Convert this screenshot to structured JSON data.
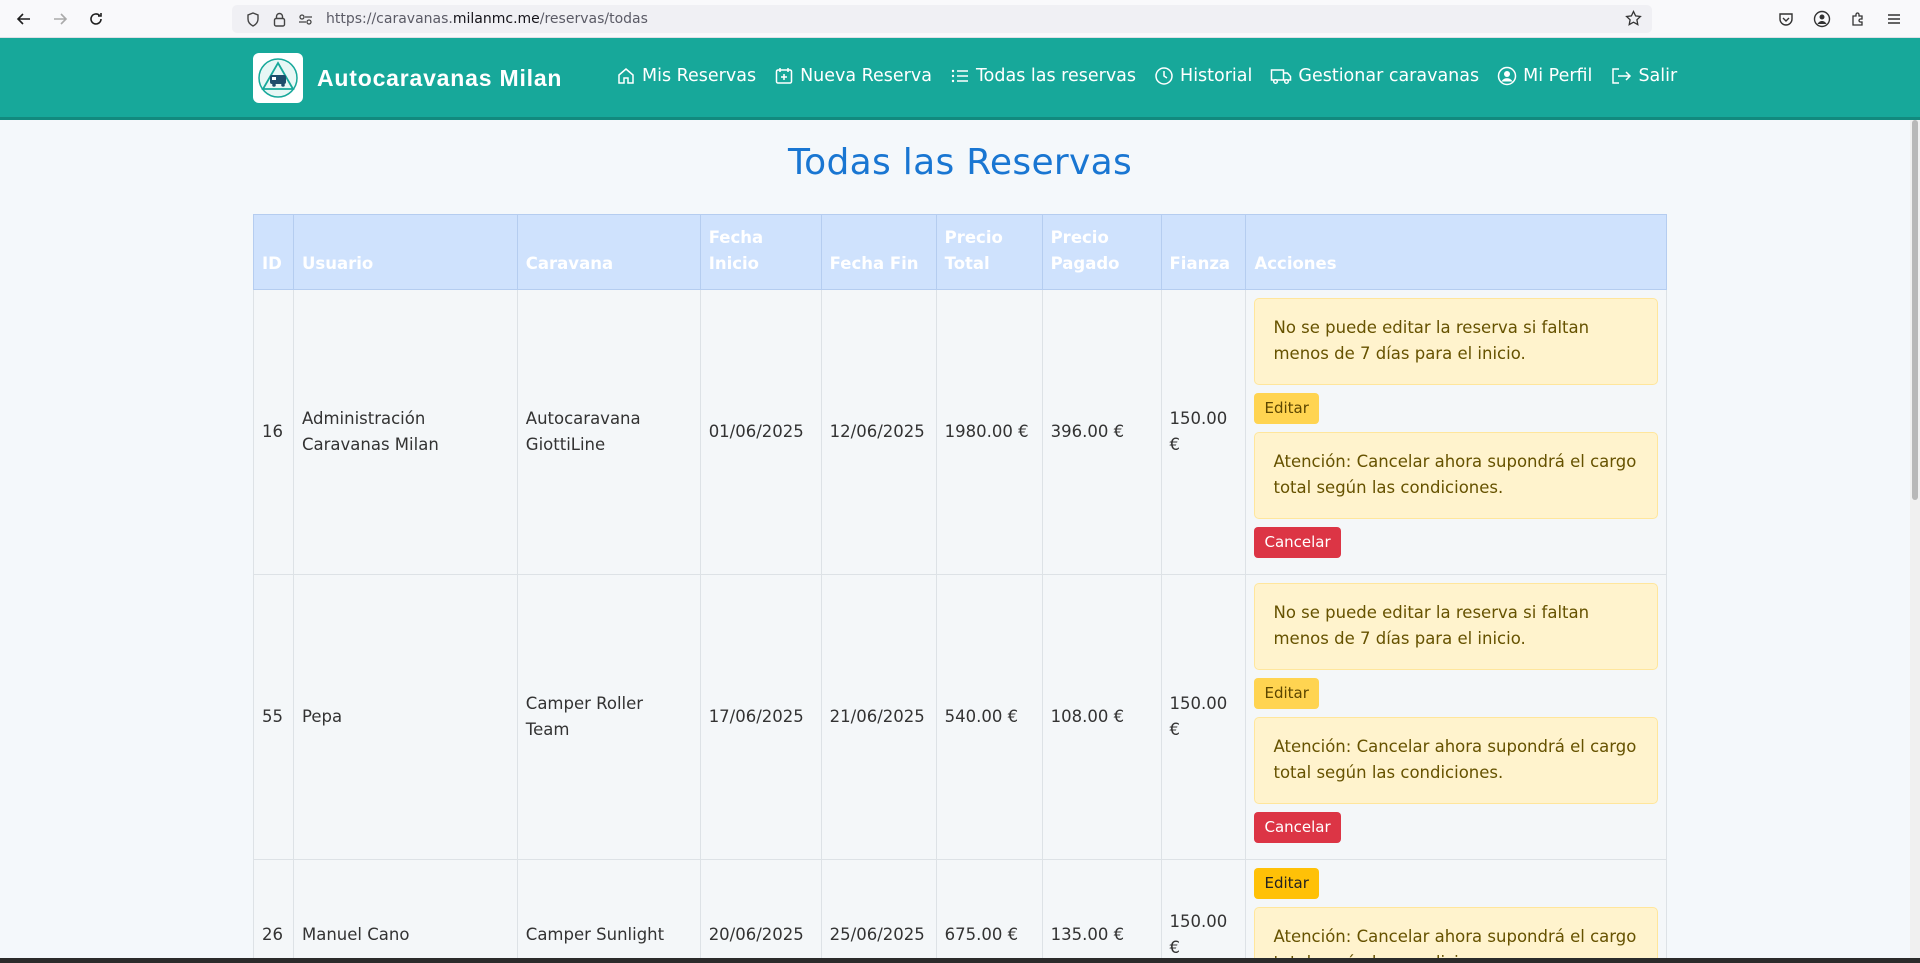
{
  "browser": {
    "url_prefix": "https://caravanas.",
    "url_domain": "milanmc.me",
    "url_path": "/reservas/todas"
  },
  "app": {
    "brand": "Autocaravanas Milan",
    "nav": [
      {
        "label": "Mis Reservas",
        "icon": "home-icon"
      },
      {
        "label": "Nueva Reserva",
        "icon": "calendar-plus-icon"
      },
      {
        "label": "Todas las reservas",
        "icon": "list-icon"
      },
      {
        "label": "Historial",
        "icon": "clock-icon"
      },
      {
        "label": "Gestionar caravanas",
        "icon": "truck-icon"
      },
      {
        "label": "Mi Perfil",
        "icon": "user-circle-icon"
      },
      {
        "label": "Salir",
        "icon": "logout-icon"
      }
    ]
  },
  "page": {
    "title": "Todas las Reservas"
  },
  "table": {
    "headers": {
      "id": "ID",
      "usuario": "Usuario",
      "caravana": "Caravana",
      "fecha_inicio": "Fecha Inicio",
      "fecha_fin": "Fecha Fin",
      "precio_total": "Precio Total",
      "precio_pagado": "Precio Pagado",
      "fianza": "Fianza",
      "acciones": "Acciones"
    },
    "rows": [
      {
        "id": "16",
        "usuario": "Administración Caravanas Milan",
        "caravana": "Autocaravana GiottiLine",
        "fecha_inicio": "01/06/2025",
        "fecha_fin": "12/06/2025",
        "precio_total": "1980.00 €",
        "precio_pagado": "396.00 €",
        "fianza": "150.00 €",
        "edit_warning": "No se puede editar la reserva si faltan menos de 7 días para el inicio.",
        "edit_label": "Editar",
        "cancel_warning": "Atención: Cancelar ahora supondrá el cargo total según las condiciones.",
        "cancel_label": "Cancelar"
      },
      {
        "id": "55",
        "usuario": "Pepa",
        "caravana": "Camper Roller Team",
        "fecha_inicio": "17/06/2025",
        "fecha_fin": "21/06/2025",
        "precio_total": "540.00 €",
        "precio_pagado": "108.00 €",
        "fianza": "150.00 €",
        "edit_warning": "No se puede editar la reserva si faltan menos de 7 días para el inicio.",
        "edit_label": "Editar",
        "cancel_warning": "Atención: Cancelar ahora supondrá el cargo total según las condiciones.",
        "cancel_label": "Cancelar"
      },
      {
        "id": "26",
        "usuario": "Manuel Cano",
        "caravana": "Camper Sunlight",
        "fecha_inicio": "20/06/2025",
        "fecha_fin": "25/06/2025",
        "precio_total": "675.00 €",
        "precio_pagado": "135.00 €",
        "fianza": "150.00 €",
        "edit_label": "Editar",
        "cancel_warning": "Atención: Cancelar ahora supondrá el cargo total según las condiciones."
      }
    ]
  }
}
